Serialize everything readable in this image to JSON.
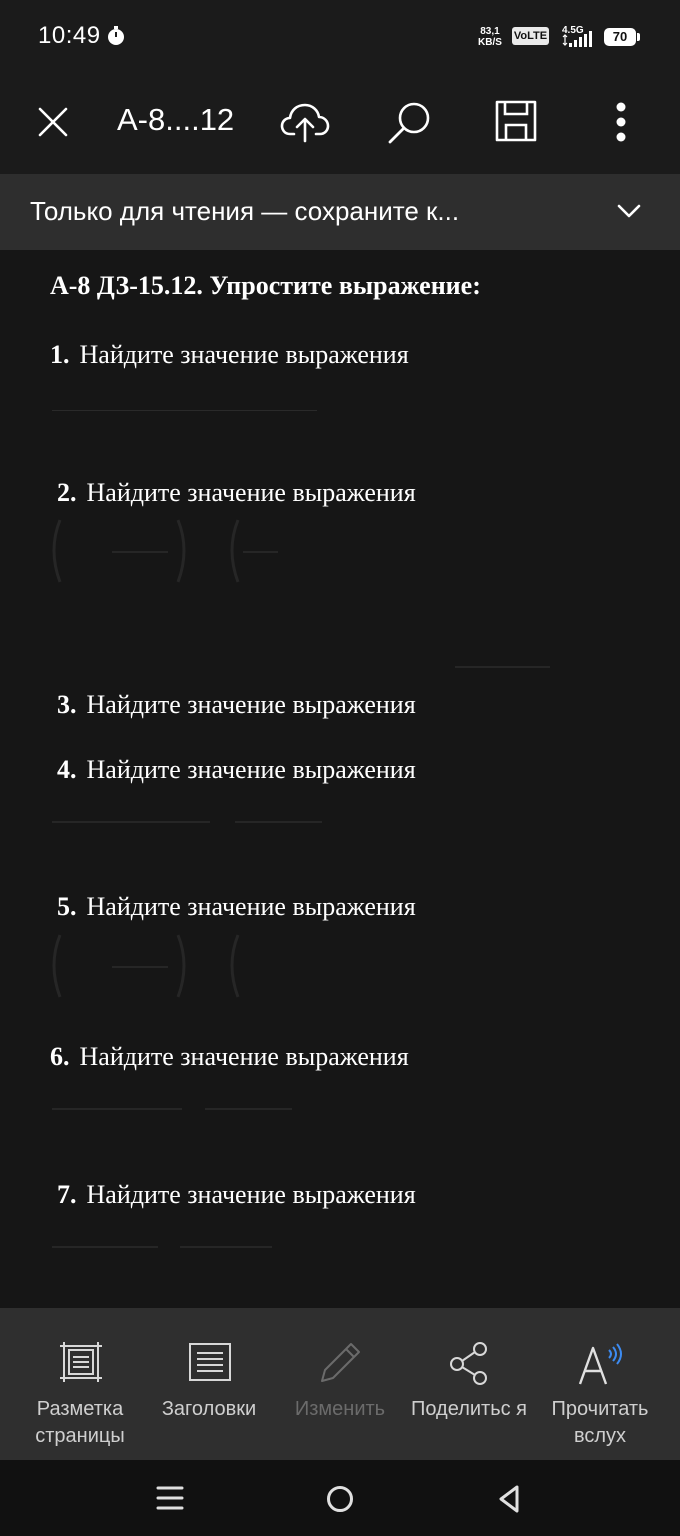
{
  "status_bar": {
    "time": "10:49",
    "net_speed_value": "83,1",
    "net_speed_unit": "KB/S",
    "volte": "VoLTE",
    "network": "4.5G",
    "battery": "70"
  },
  "toolbar": {
    "title": "А-8....12",
    "icons": [
      "close-icon",
      "cloud-upload-icon",
      "search-icon",
      "save-icon",
      "more-vert-icon"
    ]
  },
  "banner": {
    "text": "Только для чтения — сохраните к..."
  },
  "document": {
    "heading": "А-8 ДЗ-15.12. Упростите выражение:",
    "tasks": [
      {
        "num": "1.",
        "text": "Найдите значение выражения"
      },
      {
        "num": "2.",
        "text": "Найдите значение выражения"
      },
      {
        "num": "3.",
        "text": "Найдите значение выражения"
      },
      {
        "num": "4.",
        "text": "Найдите значение выражения"
      },
      {
        "num": "5.",
        "text": "Найдите значение выражения"
      },
      {
        "num": "6.",
        "text": "Найдите значение выражения"
      },
      {
        "num": "7.",
        "text": "Найдите значение выражения"
      }
    ]
  },
  "bottom_bar": {
    "items": [
      {
        "label": "Разметка страницы",
        "icon": "page-layout-icon"
      },
      {
        "label": "Заголовки",
        "icon": "headings-icon"
      },
      {
        "label": "Изменить",
        "icon": "pencil-icon"
      },
      {
        "label": "Поделитьс я",
        "icon": "share-icon"
      },
      {
        "label": "Прочитать вслух",
        "icon": "read-aloud-icon"
      }
    ]
  },
  "colors": {
    "background": "#171717",
    "banner": "#2e2e2e",
    "bottom_bar": "#2f2f2f",
    "text": "#ffffff",
    "disabled": "#6b6b6b"
  }
}
